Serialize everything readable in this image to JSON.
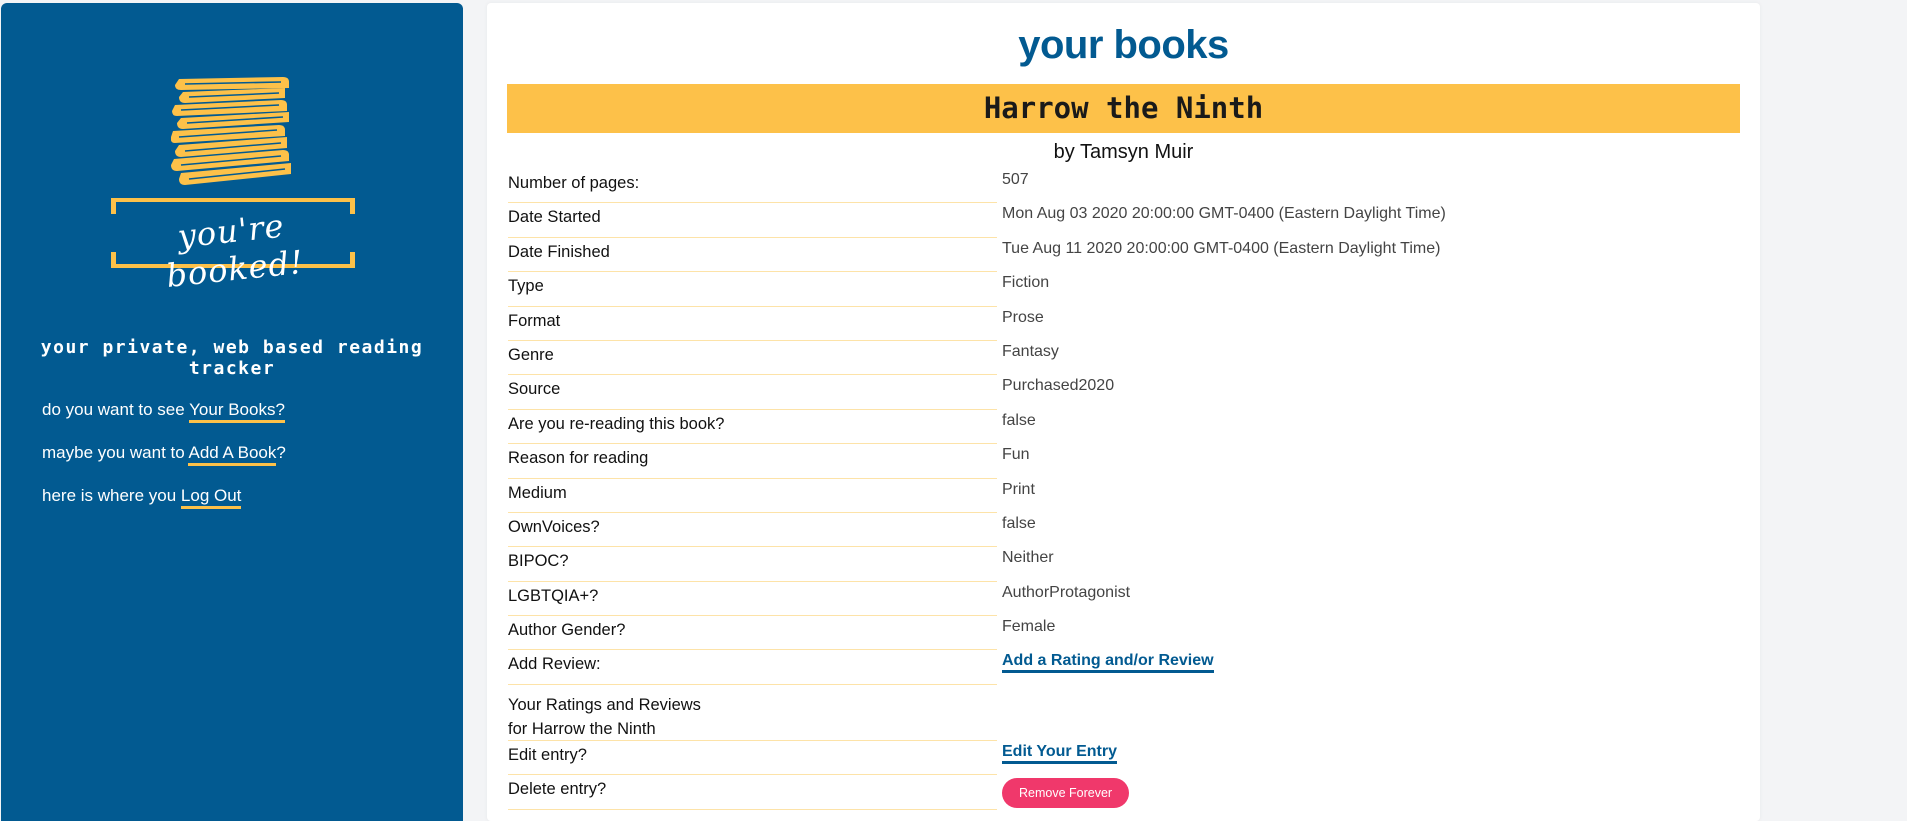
{
  "sidebar": {
    "logo_text": "you're booked!",
    "tagline": "your private, web based reading tracker",
    "nav": [
      {
        "prefix": "do you want to see ",
        "link": "Your Books?",
        "suffix": ""
      },
      {
        "prefix": "maybe you want to ",
        "link": "Add A Book",
        "suffix": "?"
      },
      {
        "prefix": "here is where you ",
        "link": "Log Out",
        "suffix": ""
      }
    ]
  },
  "colors": {
    "sidebar_bg": "#025a91",
    "accent": "#fdc149",
    "danger": "#f0386b"
  },
  "main": {
    "page_title": "your books",
    "book_title": "Harrow the Ninth",
    "author_line": "by Tamsyn Muir",
    "rows": [
      {
        "label": "Number of pages:",
        "value": "507"
      },
      {
        "label": "Date Started",
        "value": "Mon Aug 03 2020 20:00:00 GMT-0400 (Eastern Daylight Time)"
      },
      {
        "label": "Date Finished",
        "value": "Tue Aug 11 2020 20:00:00 GMT-0400 (Eastern Daylight Time)"
      },
      {
        "label": "Type",
        "value": "Fiction"
      },
      {
        "label": "Format",
        "value": "Prose"
      },
      {
        "label": "Genre",
        "value": "Fantasy"
      },
      {
        "label": "Source",
        "value": "Purchased2020"
      },
      {
        "label": "Are you re-reading this book?",
        "value": "false"
      },
      {
        "label": "Reason for reading",
        "value": "Fun"
      },
      {
        "label": "Medium",
        "value": "Print"
      },
      {
        "label": "OwnVoices?",
        "value": "false"
      },
      {
        "label": "BIPOC?",
        "value": "Neither"
      },
      {
        "label": "LGBTQIA+?",
        "value": "AuthorProtagonist"
      },
      {
        "label": "Author Gender?",
        "value": "Female"
      }
    ],
    "add_review": {
      "label": "Add Review:",
      "link": "Add a Rating and/or Review"
    },
    "ratings": {
      "line1": "Your Ratings and Reviews",
      "line2": "for Harrow the Ninth"
    },
    "edit": {
      "label": "Edit entry?",
      "link": "Edit Your Entry"
    },
    "delete": {
      "label": "Delete entry?",
      "button": "Remove Forever"
    }
  }
}
